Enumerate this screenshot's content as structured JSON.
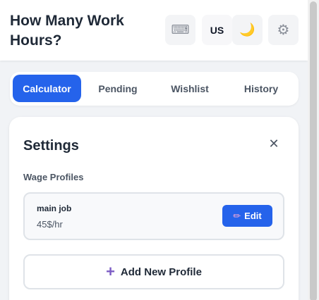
{
  "header": {
    "title": "How Many Work Hours?",
    "buttons": [
      {
        "icon": "keyboard-icon",
        "glyph": "⌨"
      },
      {
        "label": "US"
      },
      {
        "icon": "moon-icon",
        "glyph": "🌙"
      },
      {
        "icon": "gear-icon",
        "glyph": "⚙"
      }
    ]
  },
  "tabs": [
    {
      "label": "Calculator",
      "active": true
    },
    {
      "label": "Pending",
      "active": false
    },
    {
      "label": "Wishlist",
      "active": false
    },
    {
      "label": "History",
      "active": false
    }
  ],
  "settings": {
    "title": "Settings",
    "close_glyph": "✕",
    "wage_profiles_label": "Wage Profiles",
    "profiles": [
      {
        "name": "main job",
        "rate": "45$/hr",
        "edit_label": "Edit",
        "edit_icon": "✏"
      }
    ],
    "add_profile_label": "Add New Profile",
    "add_icon": "+"
  },
  "colors": {
    "accent": "#2563eb",
    "plus_icon": "#7c5cc4",
    "background": "#f1f3f6"
  }
}
